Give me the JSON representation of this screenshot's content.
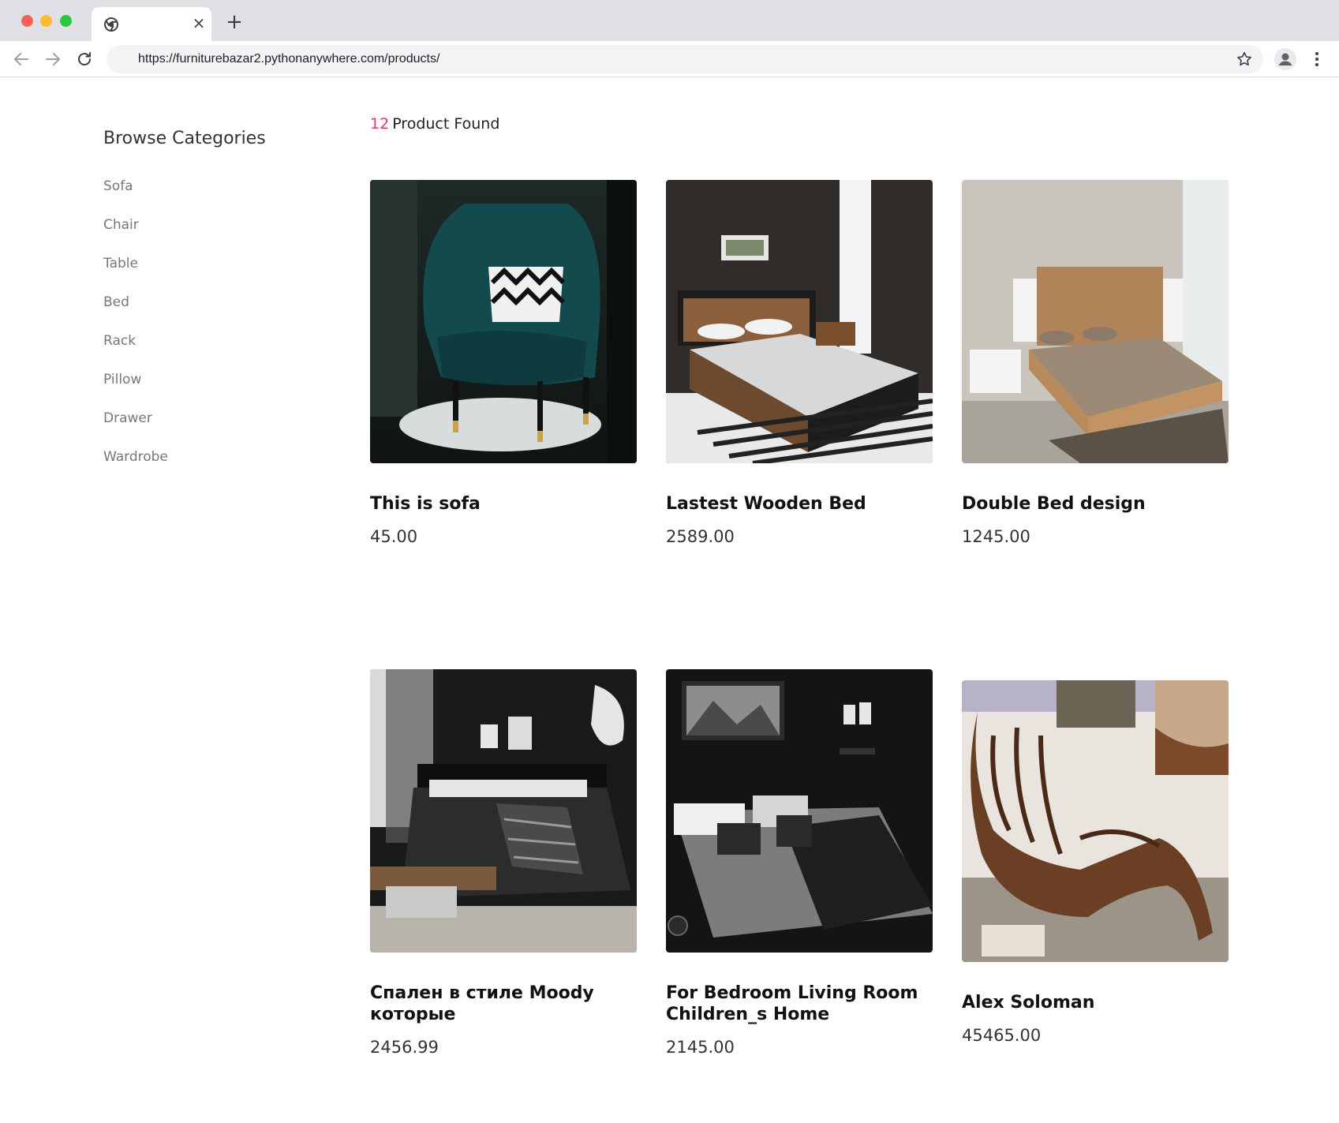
{
  "browser": {
    "url": "https://furniturebazar2.pythonanywhere.com/products/",
    "tab_close": "×",
    "new_tab": "+"
  },
  "sidebar": {
    "title": "Browse Categories",
    "categories": [
      "Sofa",
      "Chair",
      "Table",
      "Bed",
      "Rack",
      "Pillow",
      "Drawer",
      "Wardrobe"
    ]
  },
  "results": {
    "count": "12",
    "label": "Product Found"
  },
  "products": [
    {
      "title": "This is sofa",
      "price": "45.00",
      "image": "teal-armchair"
    },
    {
      "title": "Lastest Wooden Bed",
      "price": "2589.00",
      "image": "wooden-bed"
    },
    {
      "title": "Double Bed design",
      "price": "1245.00",
      "image": "floating-double-bed"
    },
    {
      "title": "Спален в стиле Moody которые",
      "price": "2456.99",
      "image": "dark-moody-bedroom"
    },
    {
      "title": "For Bedroom Living Room Children_s Home",
      "price": "2145.00",
      "image": "black-bedroom"
    },
    {
      "title": "Alex Soloman",
      "price": "45465.00",
      "image": "brown-chaise-lounge"
    }
  ],
  "colors": {
    "accent": "#e8336a",
    "tabbar": "#dfe1e5",
    "omnibox": "#f1f3f4"
  },
  "icons": [
    "back-arrow-icon",
    "forward-arrow-icon",
    "reload-icon",
    "star-icon",
    "profile-icon",
    "more-menu-icon",
    "chrome-favicon-icon"
  ]
}
